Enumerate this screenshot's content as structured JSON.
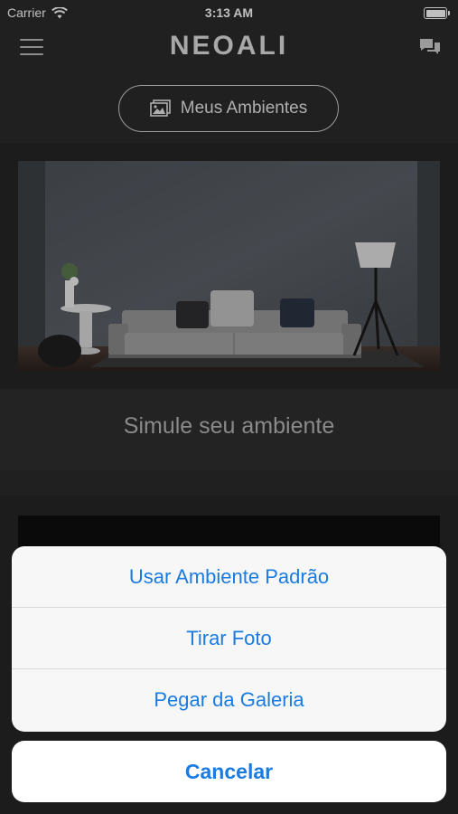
{
  "status_bar": {
    "carrier": "Carrier",
    "time": "3:13 AM",
    "wifi_icon": "wifi-icon",
    "battery_icon": "battery-icon"
  },
  "navbar": {
    "logo": "NEOALI",
    "menu_icon": "hamburger-menu-icon",
    "chat_icon": "chat-bubbles-icon"
  },
  "meus_ambientes": {
    "label": "Meus Ambientes",
    "icon": "gallery-icon"
  },
  "cards": [
    {
      "caption": "Simule seu ambiente",
      "image": "living-room-photo"
    }
  ],
  "action_sheet": {
    "options": [
      "Usar Ambiente Padrão",
      "Tirar Foto",
      "Pegar da Galeria"
    ],
    "cancel": "Cancelar"
  },
  "colors": {
    "action_text": "#1a7be0",
    "background": "#2b2b2b"
  }
}
